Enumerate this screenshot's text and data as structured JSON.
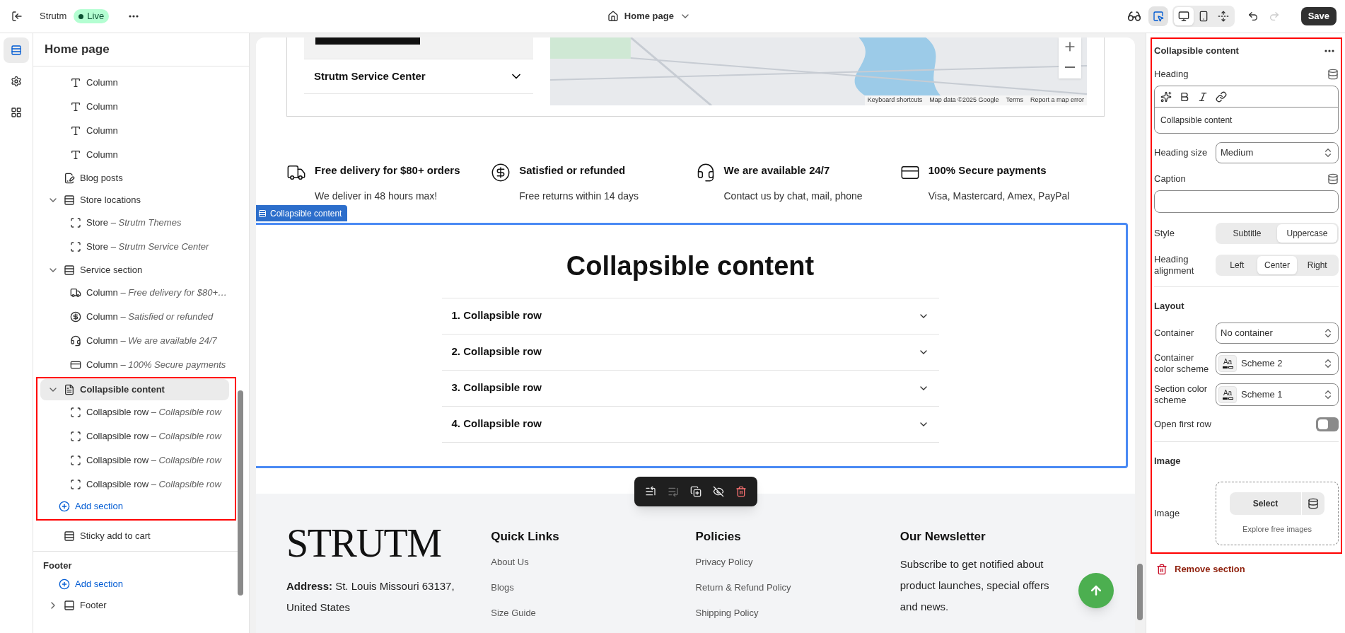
{
  "top_bar": {
    "store_name": "Strutm",
    "status": "Live",
    "page_selector": "Home page",
    "inspector_on": true,
    "view_modes": [
      {
        "kind": "desktop",
        "selected": true
      },
      {
        "kind": "mobile",
        "selected": false
      },
      {
        "kind": "fullscreen",
        "selected": false
      }
    ],
    "undo_disabled": false,
    "redo_disabled": true,
    "save": "Save"
  },
  "rail": [
    {
      "kind": "sections",
      "selected": true
    },
    {
      "kind": "settings",
      "selected": false
    },
    {
      "kind": "apps",
      "selected": false
    }
  ],
  "sidebar": {
    "title": "Home page",
    "tree": [
      {
        "children": [
          {
            "kind": "logo",
            "label": "Column",
            "selected": false
          },
          {
            "kind": "logo",
            "label": "Column",
            "selected": false
          },
          {
            "kind": "logo",
            "label": "Column",
            "selected": false
          },
          {
            "kind": "logo",
            "label": "Column",
            "selected": false
          }
        ]
      },
      {
        "kind": "blog",
        "label": "Blog posts",
        "selected": false
      },
      {
        "kind": "section",
        "label": "Store locations",
        "expanded": true,
        "selected": false,
        "children": [
          {
            "kind": "block",
            "label": "Store",
            "detail": "– Strutm Themes",
            "selected": false
          },
          {
            "kind": "block",
            "label": "Store",
            "detail": "– Strutm Service Center",
            "selected": false
          }
        ]
      },
      {
        "kind": "section",
        "label": "Service section",
        "expanded": true,
        "selected": false,
        "children": [
          {
            "kind": "truck",
            "label": "Column",
            "detail": "– Free delivery for $80+…",
            "selected": false
          },
          {
            "kind": "dollar",
            "label": "Column",
            "detail": "– Satisfied or refunded",
            "selected": false
          },
          {
            "kind": "support",
            "label": "Column",
            "detail": "– We are available 24/7",
            "selected": false
          },
          {
            "kind": "card",
            "label": "Column",
            "detail": "– 100% Secure payments",
            "selected": false
          }
        ]
      },
      {
        "kind": "collapsible",
        "label": "Collapsible content",
        "expanded": true,
        "selected": true,
        "children": [
          {
            "kind": "block",
            "label": "Collapsible row",
            "detail": "– Collapsible row",
            "selected": false
          },
          {
            "kind": "block",
            "label": "Collapsible row",
            "detail": "– Collapsible row",
            "selected": false
          },
          {
            "kind": "block",
            "label": "Collapsible row",
            "detail": "– Collapsible row",
            "selected": false
          },
          {
            "kind": "block",
            "label": "Collapsible row",
            "detail": "– Collapsible row",
            "selected": false
          }
        ]
      }
    ],
    "add_section": "Add section",
    "after": [
      {
        "kind": "section",
        "label": "Sticky add to cart",
        "selected": false
      }
    ],
    "footer": {
      "title": "Footer",
      "add_section": "Add section",
      "items": [
        {
          "kind": "footer",
          "label": "Footer",
          "expanded": false,
          "selected": false
        }
      ]
    }
  },
  "preview": {
    "store_locations": {
      "store_title": "Strutm Service Center",
      "map_attribution": [
        "Keyboard shortcuts",
        "Map data ©2025 Google",
        "Terms",
        "Report a map error"
      ]
    },
    "services": [
      {
        "kind": "truck",
        "title": "Free delivery for $80+ orders",
        "text": "We deliver in 48 hours max!"
      },
      {
        "kind": "dollar",
        "title": "Satisfied or refunded",
        "text": "Free returns within 14 days"
      },
      {
        "kind": "support",
        "title": "We are available 24/7",
        "text": "Contact us by chat, mail, phone"
      },
      {
        "kind": "card",
        "title": "100% Secure payments",
        "text": "Visa, Mastercard, Amex, PayPal"
      }
    ],
    "collapsible": {
      "tag": "Collapsible content",
      "heading": "Collapsible content",
      "rows": [
        {
          "title": "1. Collapsible row"
        },
        {
          "title": "2. Collapsible row"
        },
        {
          "title": "3. Collapsible row"
        },
        {
          "title": "4. Collapsible row"
        }
      ]
    },
    "section_toolbar": [
      {
        "kind": "move_up",
        "disabled": false
      },
      {
        "kind": "move_down",
        "disabled": true
      },
      {
        "kind": "duplicate",
        "disabled": false
      },
      {
        "kind": "hide",
        "disabled": false
      },
      {
        "kind": "remove",
        "disabled": false
      }
    ],
    "footer": {
      "logo": "STRUTM",
      "address": "**Address:** St. Louis Missouri 63137, United States",
      "columns": [
        {
          "title": "Quick Links",
          "links": [
            "About Us",
            "Blogs",
            "Size Guide"
          ]
        },
        {
          "title": "Policies",
          "links": [
            "Privacy Policy",
            "Return & Refund Policy",
            "Shipping Policy"
          ]
        }
      ],
      "newsletter": {
        "title": "Our Newsletter",
        "text": "Subscribe to get notified about product launches, special offers and news."
      }
    }
  },
  "settings": {
    "title": "Collapsible content",
    "fields": [
      {
        "kind": "rich_text",
        "label": "Heading",
        "value": "Collapsible content"
      },
      {
        "kind": "select",
        "label": "Heading size",
        "value": "Medium"
      },
      {
        "kind": "text",
        "label": "Caption"
      },
      {
        "kind": "segmented",
        "label": "Style",
        "options": [
          {
            "label": "Subtitle",
            "selected": false
          },
          {
            "label": "Uppercase",
            "selected": true
          }
        ]
      },
      {
        "kind": "segmented",
        "label": "Heading alignment",
        "options": [
          {
            "label": "Left",
            "selected": false
          },
          {
            "label": "Center",
            "selected": true
          },
          {
            "label": "Right",
            "selected": false
          }
        ]
      },
      {
        "kind": "header",
        "label": "Layout"
      },
      {
        "kind": "select",
        "label": "Container",
        "value": "No container"
      },
      {
        "kind": "scheme",
        "label": "Container color scheme",
        "value": "Scheme 2",
        "swatch": "Aa"
      },
      {
        "kind": "scheme",
        "label": "Section color scheme",
        "value": "Scheme 1",
        "swatch": "Aa"
      },
      {
        "kind": "toggle",
        "label": "Open first row",
        "on": false
      },
      {
        "kind": "header",
        "label": "Image"
      },
      {
        "kind": "image",
        "label": "Image",
        "button": "Select",
        "link": "Explore free images"
      }
    ],
    "remove": "Remove section"
  }
}
